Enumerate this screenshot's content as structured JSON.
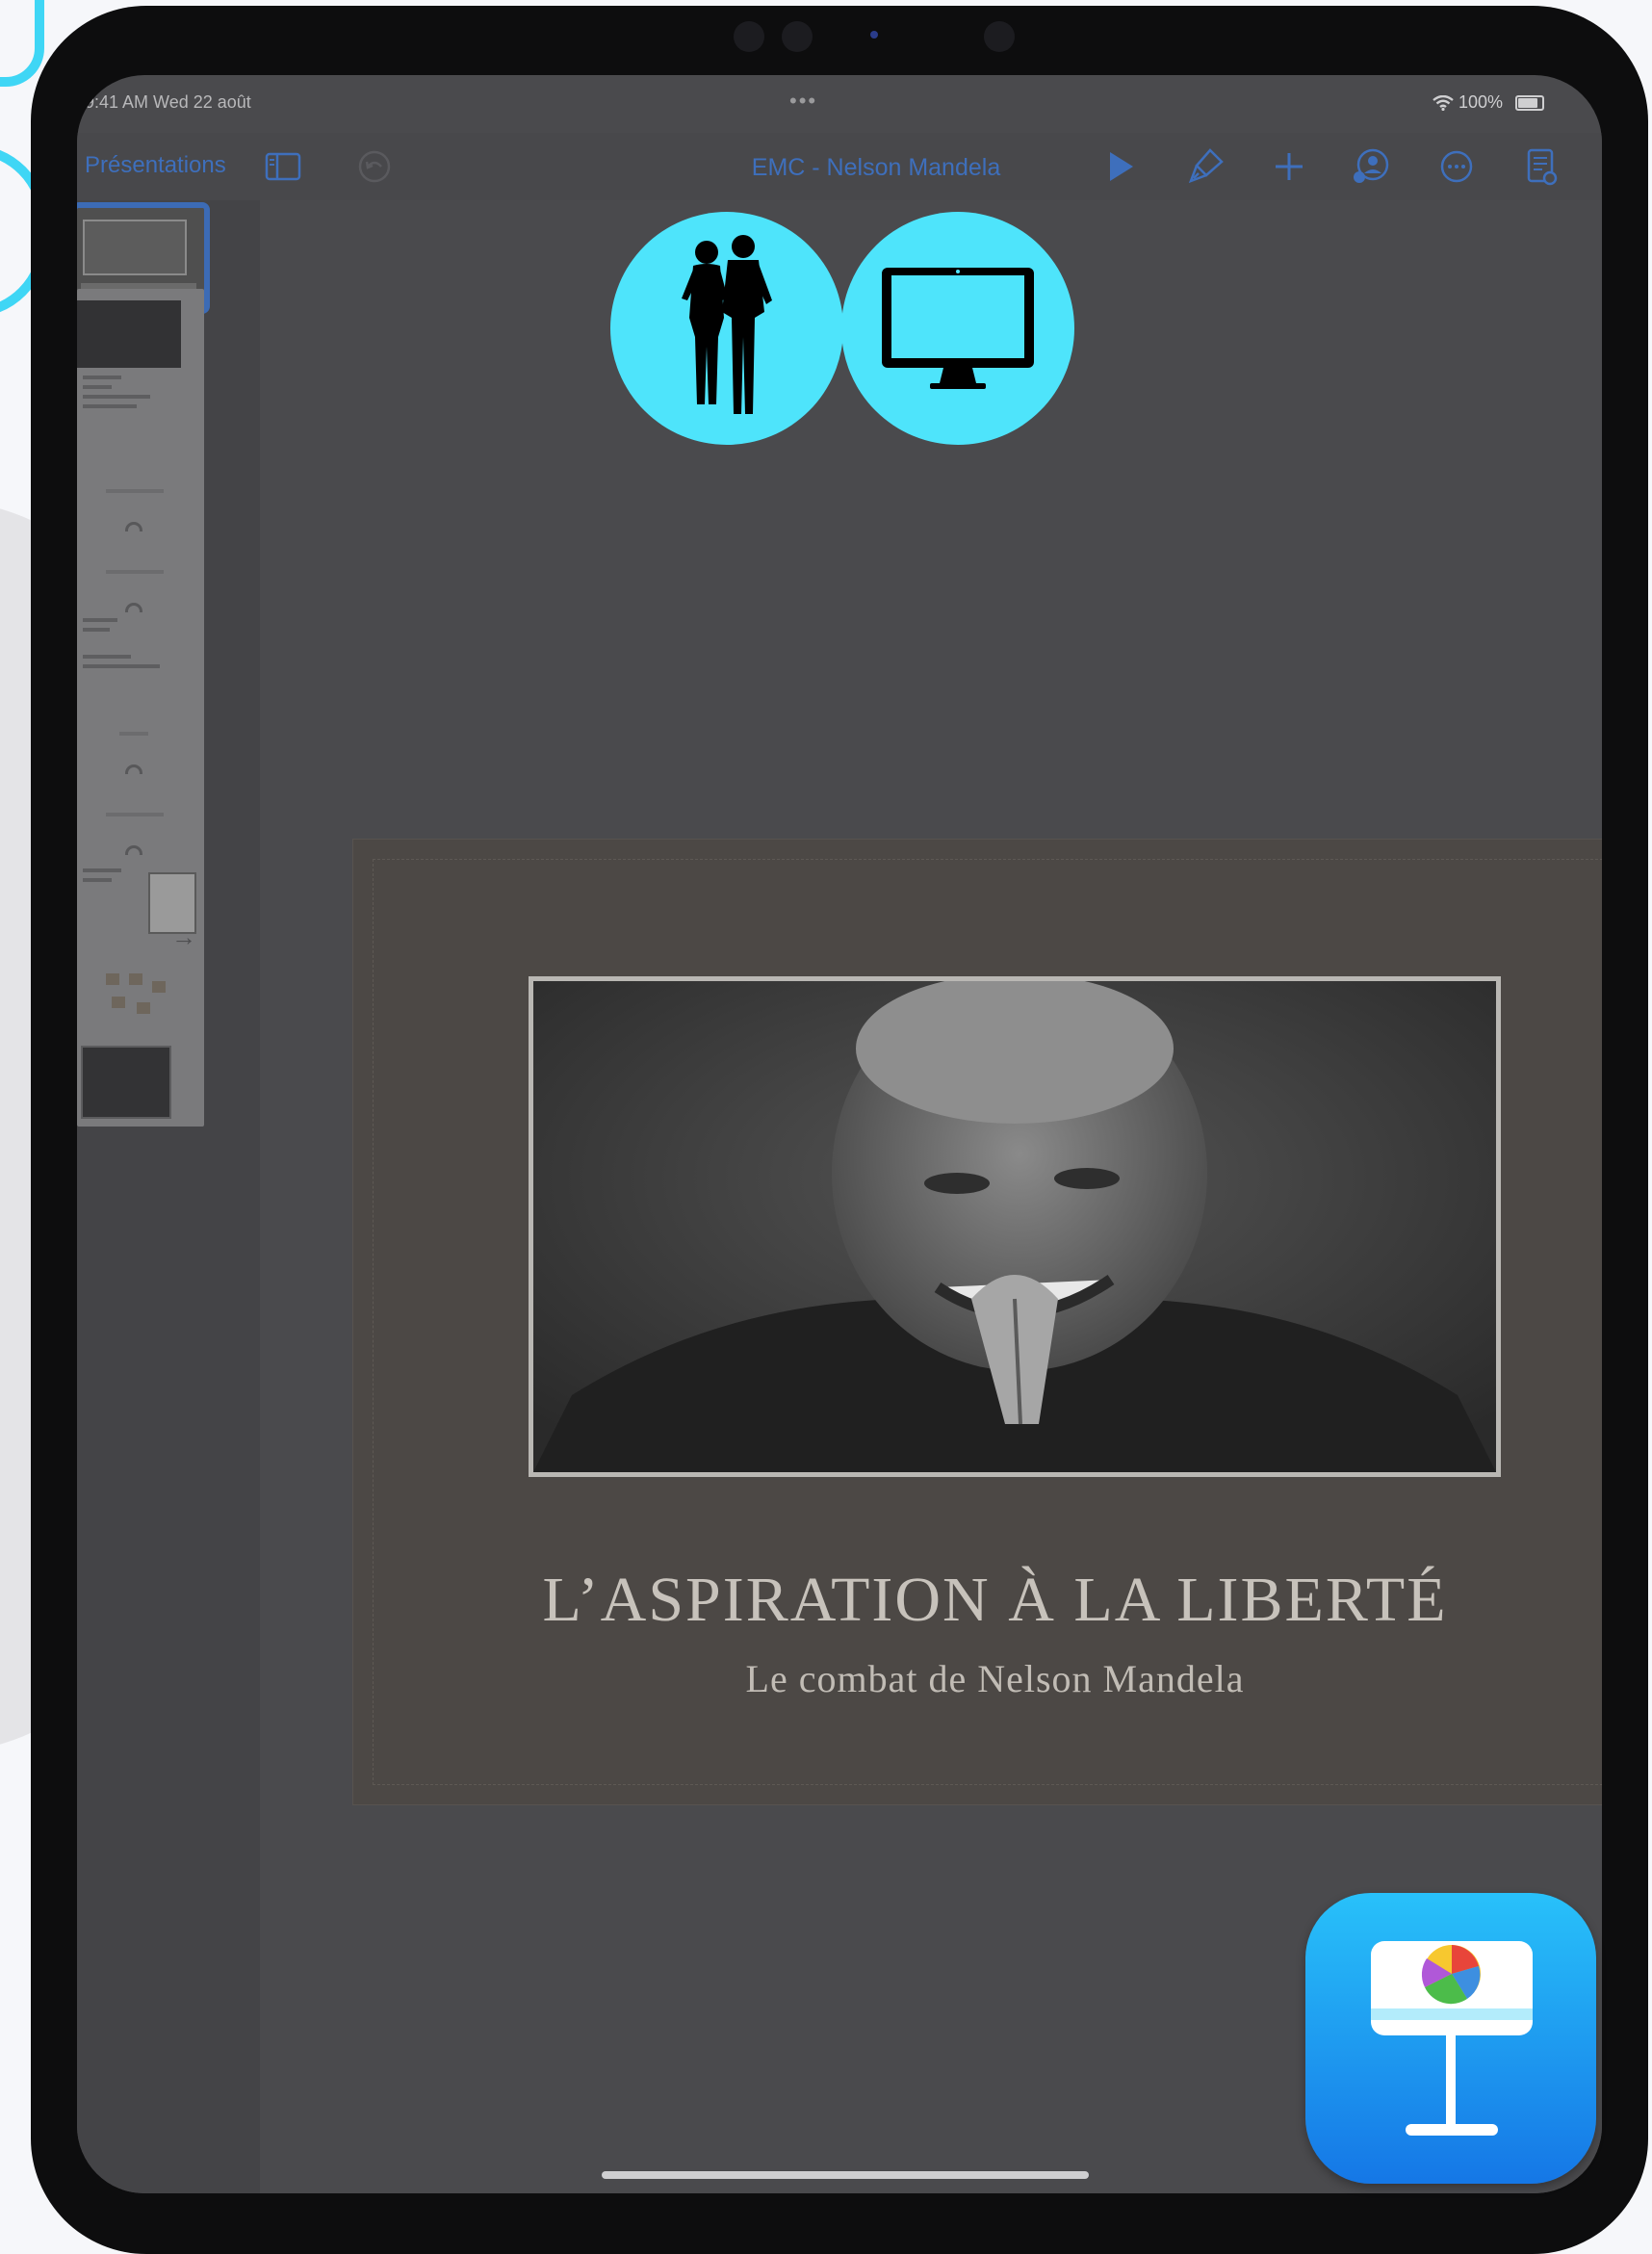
{
  "status_bar": {
    "time": "9:41 AM  Wed 22 août",
    "battery": "100%"
  },
  "toolbar": {
    "back_label": "Présentations",
    "document_title": "EMC - Nelson Mandela",
    "icons": [
      "sidebar-icon",
      "undo-icon",
      "play-icon",
      "format-brush-icon",
      "add-icon",
      "collaborate-icon",
      "more-icon",
      "presenter-notes-icon"
    ]
  },
  "navigator": {
    "slide_count": 11,
    "selected_index": 0,
    "add_slide_icon": "plus-square-icon"
  },
  "slide": {
    "title": "L’ASPIRATION À LA LIBERTÉ",
    "subtitle": "Le combat de Nelson Mandela"
  },
  "overlay_badges": [
    {
      "name": "people-icon",
      "color": "#4ee4fb"
    },
    {
      "name": "monitor-icon",
      "color": "#4ee4fb"
    }
  ],
  "app_logo": {
    "name": "keynote-app-icon"
  },
  "colors": {
    "accent": "#3e6fbc",
    "badge": "#4ee4fb",
    "screen_bg": "#4a4a4d"
  }
}
